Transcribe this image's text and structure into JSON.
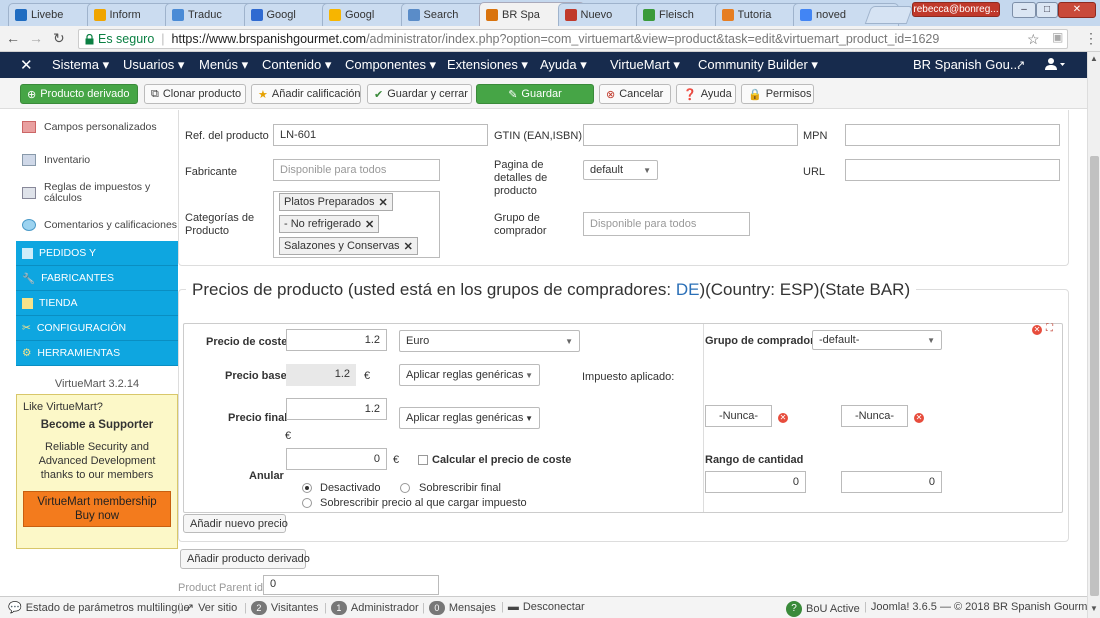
{
  "browser": {
    "tabs": [
      {
        "title": "Livebe",
        "icon_color": "#1f6cc1"
      },
      {
        "title": "Inform",
        "icon_color": "#f0a500"
      },
      {
        "title": "Traduc",
        "icon_color": "#4a8bd6"
      },
      {
        "title": "Googl",
        "icon_color": "#2f6ad1"
      },
      {
        "title": "Googl",
        "icon_color": "#f7b500"
      },
      {
        "title": "Search",
        "icon_color": "#5a8cc8"
      },
      {
        "title": "BR Spa",
        "icon_color": "#d9730d"
      },
      {
        "title": "Nuevo",
        "icon_color": "#c0392b"
      },
      {
        "title": "Fleisch",
        "icon_color": "#3a9a3a"
      },
      {
        "title": "Tutoria",
        "icon_color": "#e67e22"
      },
      {
        "title": "noved",
        "icon_color": "#4285f4"
      }
    ],
    "active_tab": 6,
    "user_badge": "rebecca@bonreg...",
    "secure_label": "Es seguro",
    "url_host": "https://www.brspanishgourmet.com",
    "url_path": "/administrator/index.php?option=com_virtuemart&view=product&task=edit&virtuemart_product_id=1629"
  },
  "topnav": {
    "items": [
      "Sistema ▾",
      "Usuarios ▾",
      "Menús ▾",
      "Contenido ▾",
      "Componentes ▾",
      "Extensiones ▾",
      "Ayuda ▾",
      "VirtueMart ▾",
      "Community Builder ▾"
    ],
    "site_name": "BR Spanish Gou...",
    "user_icon": "user-icon"
  },
  "toolbar": {
    "derived": "Producto derivado",
    "clone": "Clonar producto",
    "rating": "Añadir calificación",
    "save_close": "Guardar y cerrar",
    "save": "Guardar",
    "cancel": "Cancelar",
    "help": "Ayuda",
    "perms": "Permisos"
  },
  "sidebar": {
    "items": [
      {
        "label": "Campos personalizados",
        "icon": "custom-fields-icon"
      },
      {
        "label": "Inventario",
        "icon": "inventory-icon"
      },
      {
        "label": "Reglas de impuestos y cálculos",
        "icon": "tax-rules-icon"
      },
      {
        "label": "Comentarios y calificaciones",
        "icon": "comments-icon"
      }
    ],
    "sections": [
      {
        "label": "PEDIDOS Y",
        "icon": "orders-icon"
      },
      {
        "label": "FABRICANTES",
        "icon": "manufacturers-icon"
      },
      {
        "label": "TIENDA",
        "icon": "shop-icon"
      },
      {
        "label": "CONFIGURACIÓN",
        "icon": "config-icon"
      },
      {
        "label": "HERRAMIENTAS",
        "icon": "tools-icon"
      }
    ],
    "version": "VirtueMart 3.2.14",
    "promo": {
      "like": "Like VirtueMart?",
      "title": "Become a Supporter",
      "body": "Reliable Security and Advanced Development thanks to our members",
      "button_line1": "VirtueMart membership",
      "button_line2": "Buy now"
    }
  },
  "product": {
    "sku_label": "Ref. del producto",
    "sku_value": "LN-601",
    "gtin_label": "GTIN (EAN,ISBN)",
    "gtin_value": "",
    "mpn_label": "MPN",
    "mpn_value": "",
    "manufacturer_label": "Fabricante",
    "manufacturer_placeholder": "Disponible para todos",
    "details_page_label": "Pagina de detalles de producto",
    "details_page_value": "default",
    "url_label": "URL",
    "url_value": "",
    "categories_label": "Categorías de Producto",
    "categories": [
      "Platos Preparados",
      "- No refrigerado",
      "Salazones y Conservas"
    ],
    "shoppergroup_label": "Grupo de comprador",
    "shoppergroup_placeholder": "Disponible para todos"
  },
  "prices": {
    "heading_prefix": "Precios de producto (usted está en los grupos de compradores: ",
    "heading_group": "DE",
    "heading_suffix": ")(Country: ESP)(State BAR)",
    "cost_label": "Precio de coste",
    "cost_value": "1.2",
    "currency": "Euro",
    "shopper_group_label": "Grupo de comprador",
    "shopper_group_value": "-default-",
    "base_label": "Precio base",
    "base_value": "1.2",
    "euro_symbol": "€",
    "apply_generic": "Aplicar reglas genéricas",
    "tax_applied_label": "Impuesto aplicado:",
    "final_label": "Precio final",
    "final_value": "1.2",
    "never_start": "-Nunca-",
    "never_end": "-Nunca-",
    "override_label": "Anular",
    "override_value": "0",
    "calc_cost_label": "Calcular el precio de coste",
    "radio_disabled": "Desactivado",
    "radio_override_final": "Sobrescribir final",
    "radio_override_tax": "Sobrescribir precio al que cargar impuesto",
    "qty_range_label": "Rango de cantidad",
    "qty_from": "0",
    "qty_to": "0",
    "add_price": "Añadir nuevo precio",
    "add_derived": "Añadir producto derivado",
    "parent_id_label": "Product Parent id",
    "parent_id_value": "0"
  },
  "statusbar": {
    "multilang": "Estado de parámetros multilingüe",
    "view_site": "Ver sitio",
    "visitors_count": "2",
    "visitors": "Visitantes",
    "admin_count": "1",
    "admin": "Administrador",
    "messages_count": "0",
    "messages": "Mensajes",
    "logout": "Desconectar",
    "bou": "BoU Active",
    "version": "Joomla! 3.6.5 — © 2018 BR Spanish Gourmet"
  }
}
